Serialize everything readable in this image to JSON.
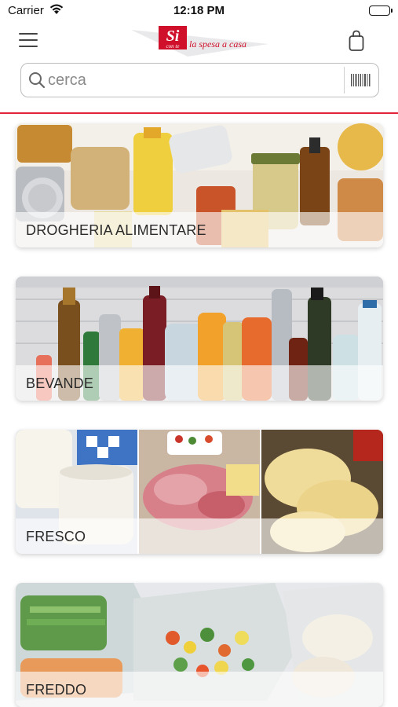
{
  "status_bar": {
    "carrier": "Carrier",
    "time": "12:18 PM"
  },
  "header": {
    "logo_mark": "Si",
    "logo_subtext": "con te",
    "logo_tagline": "la spesa a casa",
    "icons": [
      "menu-icon",
      "logo-icon",
      "shopping-bag-icon"
    ]
  },
  "search": {
    "placeholder": "cerca",
    "value": "",
    "icons": [
      "search-icon",
      "barcode-icon"
    ]
  },
  "colors": {
    "brand_red": "#e0253a",
    "text_dark": "#2a2a2a"
  },
  "categories": [
    {
      "label": "DROGHERIA ALIMENTARE"
    },
    {
      "label": "BEVANDE"
    },
    {
      "label": "FRESCO"
    },
    {
      "label": "FREDDO"
    }
  ]
}
